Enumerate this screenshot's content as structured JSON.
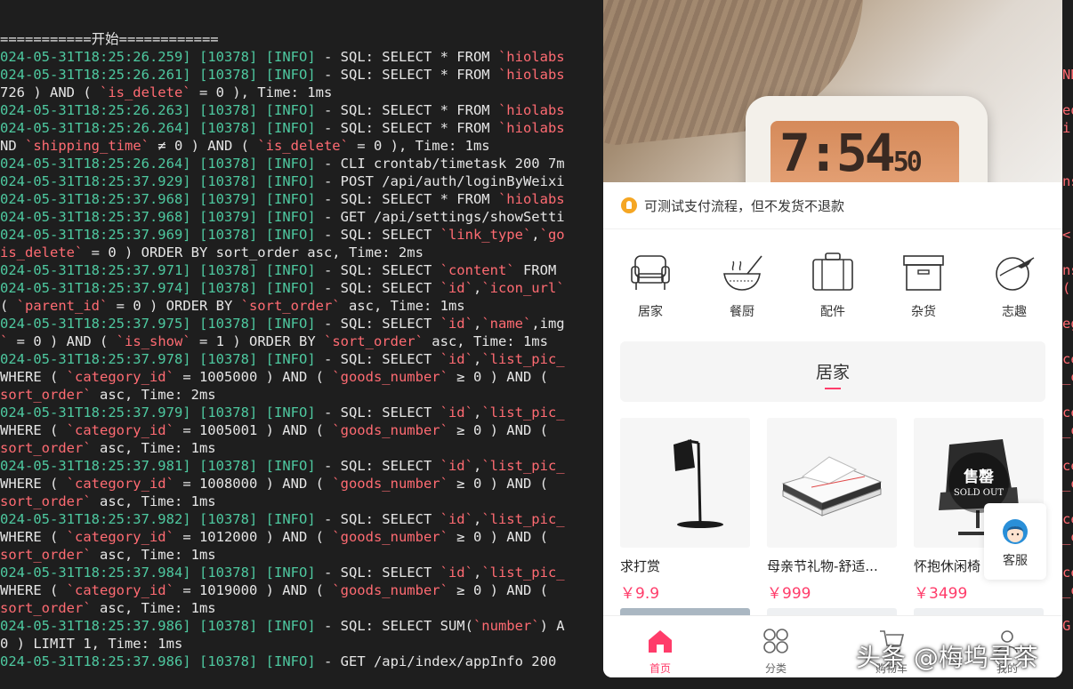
{
  "terminal": {
    "lines": [
      [
        {
          "c": "txt",
          "t": "===========开始============"
        }
      ],
      [
        {
          "c": "ts",
          "t": "024-05-31T18:25:26.259]"
        },
        {
          "c": "txt",
          "t": " "
        },
        {
          "c": "pid",
          "t": "[10378]"
        },
        {
          "c": "txt",
          "t": " "
        },
        {
          "c": "lvl",
          "t": "[INFO]"
        },
        {
          "c": "txt",
          "t": " - SQL: SELECT * FROM "
        },
        {
          "c": "bt",
          "t": "`hiolabs"
        }
      ],
      [
        {
          "c": "ts",
          "t": "024-05-31T18:25:26.261]"
        },
        {
          "c": "txt",
          "t": " "
        },
        {
          "c": "pid",
          "t": "[10378]"
        },
        {
          "c": "txt",
          "t": " "
        },
        {
          "c": "lvl",
          "t": "[INFO]"
        },
        {
          "c": "txt",
          "t": " - SQL: SELECT * FROM "
        },
        {
          "c": "bt",
          "t": "`hiolabs"
        }
      ],
      [
        {
          "c": "txt",
          "t": "726 ) AND ( "
        },
        {
          "c": "bt",
          "t": "`is_delete`"
        },
        {
          "c": "txt",
          "t": " = 0 ), Time: 1ms"
        }
      ],
      [
        {
          "c": "ts",
          "t": "024-05-31T18:25:26.263]"
        },
        {
          "c": "txt",
          "t": " "
        },
        {
          "c": "pid",
          "t": "[10378]"
        },
        {
          "c": "txt",
          "t": " "
        },
        {
          "c": "lvl",
          "t": "[INFO]"
        },
        {
          "c": "txt",
          "t": " - SQL: SELECT * FROM "
        },
        {
          "c": "bt",
          "t": "`hiolabs"
        }
      ],
      [
        {
          "c": "ts",
          "t": "024-05-31T18:25:26.264]"
        },
        {
          "c": "txt",
          "t": " "
        },
        {
          "c": "pid",
          "t": "[10378]"
        },
        {
          "c": "txt",
          "t": " "
        },
        {
          "c": "lvl",
          "t": "[INFO]"
        },
        {
          "c": "txt",
          "t": " - SQL: SELECT * FROM "
        },
        {
          "c": "bt",
          "t": "`hiolabs"
        }
      ],
      [
        {
          "c": "txt",
          "t": "ND "
        },
        {
          "c": "bt",
          "t": "`shipping_time`"
        },
        {
          "c": "txt",
          "t": " ≠ 0 ) AND ( "
        },
        {
          "c": "bt",
          "t": "`is_delete`"
        },
        {
          "c": "txt",
          "t": " = 0 ), Time: 1ms"
        }
      ],
      [
        {
          "c": "ts",
          "t": "024-05-31T18:25:26.264]"
        },
        {
          "c": "txt",
          "t": " "
        },
        {
          "c": "pid",
          "t": "[10378]"
        },
        {
          "c": "txt",
          "t": " "
        },
        {
          "c": "lvl",
          "t": "[INFO]"
        },
        {
          "c": "txt",
          "t": " - CLI crontab/timetask 200 7m"
        }
      ],
      [
        {
          "c": "ts",
          "t": "024-05-31T18:25:37.929]"
        },
        {
          "c": "txt",
          "t": " "
        },
        {
          "c": "pid",
          "t": "[10378]"
        },
        {
          "c": "txt",
          "t": " "
        },
        {
          "c": "lvl",
          "t": "[INFO]"
        },
        {
          "c": "txt",
          "t": " - POST /api/auth/loginByWeixi"
        }
      ],
      [
        {
          "c": "ts",
          "t": "024-05-31T18:25:37.968]"
        },
        {
          "c": "txt",
          "t": " "
        },
        {
          "c": "pid",
          "t": "[10379]"
        },
        {
          "c": "txt",
          "t": " "
        },
        {
          "c": "lvl",
          "t": "[INFO]"
        },
        {
          "c": "txt",
          "t": " - SQL: SELECT * FROM "
        },
        {
          "c": "bt",
          "t": "`hiolabs"
        }
      ],
      [
        {
          "c": "ts",
          "t": "024-05-31T18:25:37.968]"
        },
        {
          "c": "txt",
          "t": " "
        },
        {
          "c": "pid",
          "t": "[10379]"
        },
        {
          "c": "txt",
          "t": " "
        },
        {
          "c": "lvl",
          "t": "[INFO]"
        },
        {
          "c": "txt",
          "t": " - GET /api/settings/showSetti"
        }
      ],
      [
        {
          "c": "ts",
          "t": "024-05-31T18:25:37.969]"
        },
        {
          "c": "txt",
          "t": " "
        },
        {
          "c": "pid",
          "t": "[10378]"
        },
        {
          "c": "txt",
          "t": " "
        },
        {
          "c": "lvl",
          "t": "[INFO]"
        },
        {
          "c": "txt",
          "t": " - SQL: SELECT "
        },
        {
          "c": "bt",
          "t": "`link_type`"
        },
        {
          "c": "txt",
          "t": ","
        },
        {
          "c": "bt",
          "t": "`go"
        }
      ],
      [
        {
          "c": "bt",
          "t": "is_delete`"
        },
        {
          "c": "txt",
          "t": " = 0 ) ORDER BY sort_order asc, Time: 2ms"
        }
      ],
      [
        {
          "c": "ts",
          "t": "024-05-31T18:25:37.971]"
        },
        {
          "c": "txt",
          "t": " "
        },
        {
          "c": "pid",
          "t": "[10378]"
        },
        {
          "c": "txt",
          "t": " "
        },
        {
          "c": "lvl",
          "t": "[INFO]"
        },
        {
          "c": "txt",
          "t": " - SQL: SELECT "
        },
        {
          "c": "bt",
          "t": "`content`"
        },
        {
          "c": "txt",
          "t": " FROM "
        }
      ],
      [
        {
          "c": "ts",
          "t": "024-05-31T18:25:37.974]"
        },
        {
          "c": "txt",
          "t": " "
        },
        {
          "c": "pid",
          "t": "[10378]"
        },
        {
          "c": "txt",
          "t": " "
        },
        {
          "c": "lvl",
          "t": "[INFO]"
        },
        {
          "c": "txt",
          "t": " - SQL: SELECT "
        },
        {
          "c": "bt",
          "t": "`id`"
        },
        {
          "c": "txt",
          "t": ","
        },
        {
          "c": "bt",
          "t": "`icon_url`"
        }
      ],
      [
        {
          "c": "txt",
          "t": "( "
        },
        {
          "c": "bt",
          "t": "`parent_id`"
        },
        {
          "c": "txt",
          "t": " = 0 ) ORDER BY "
        },
        {
          "c": "bt",
          "t": "`sort_order`"
        },
        {
          "c": "txt",
          "t": " asc, Time: 1ms"
        }
      ],
      [
        {
          "c": "ts",
          "t": "024-05-31T18:25:37.975]"
        },
        {
          "c": "txt",
          "t": " "
        },
        {
          "c": "pid",
          "t": "[10378]"
        },
        {
          "c": "txt",
          "t": " "
        },
        {
          "c": "lvl",
          "t": "[INFO]"
        },
        {
          "c": "txt",
          "t": " - SQL: SELECT "
        },
        {
          "c": "bt",
          "t": "`id`"
        },
        {
          "c": "txt",
          "t": ","
        },
        {
          "c": "bt",
          "t": "`name`"
        },
        {
          "c": "txt",
          "t": ",img"
        }
      ],
      [
        {
          "c": "bt",
          "t": "`"
        },
        {
          "c": "txt",
          "t": " = 0 ) AND ( "
        },
        {
          "c": "bt",
          "t": "`is_show`"
        },
        {
          "c": "txt",
          "t": " = 1 ) ORDER BY "
        },
        {
          "c": "bt",
          "t": "`sort_order`"
        },
        {
          "c": "txt",
          "t": " asc, Time: 1ms"
        }
      ],
      [
        {
          "c": "ts",
          "t": "024-05-31T18:25:37.978]"
        },
        {
          "c": "txt",
          "t": " "
        },
        {
          "c": "pid",
          "t": "[10378]"
        },
        {
          "c": "txt",
          "t": " "
        },
        {
          "c": "lvl",
          "t": "[INFO]"
        },
        {
          "c": "txt",
          "t": " - SQL: SELECT "
        },
        {
          "c": "bt",
          "t": "`id`"
        },
        {
          "c": "txt",
          "t": ","
        },
        {
          "c": "bt",
          "t": "`list_pic_"
        }
      ],
      [
        {
          "c": "txt",
          "t": "WHERE ( "
        },
        {
          "c": "bt",
          "t": "`category_id`"
        },
        {
          "c": "txt",
          "t": " = 1005000 ) AND ( "
        },
        {
          "c": "bt",
          "t": "`goods_number`"
        },
        {
          "c": "txt",
          "t": " ≥ 0 ) AND ("
        }
      ],
      [
        {
          "c": "bt",
          "t": "sort_order`"
        },
        {
          "c": "txt",
          "t": " asc, Time: 2ms"
        }
      ],
      [
        {
          "c": "ts",
          "t": "024-05-31T18:25:37.979]"
        },
        {
          "c": "txt",
          "t": " "
        },
        {
          "c": "pid",
          "t": "[10378]"
        },
        {
          "c": "txt",
          "t": " "
        },
        {
          "c": "lvl",
          "t": "[INFO]"
        },
        {
          "c": "txt",
          "t": " - SQL: SELECT "
        },
        {
          "c": "bt",
          "t": "`id`"
        },
        {
          "c": "txt",
          "t": ","
        },
        {
          "c": "bt",
          "t": "`list_pic_"
        }
      ],
      [
        {
          "c": "txt",
          "t": "WHERE ( "
        },
        {
          "c": "bt",
          "t": "`category_id`"
        },
        {
          "c": "txt",
          "t": " = 1005001 ) AND ( "
        },
        {
          "c": "bt",
          "t": "`goods_number`"
        },
        {
          "c": "txt",
          "t": " ≥ 0 ) AND ("
        }
      ],
      [
        {
          "c": "bt",
          "t": "sort_order`"
        },
        {
          "c": "txt",
          "t": " asc, Time: 1ms"
        }
      ],
      [
        {
          "c": "ts",
          "t": "024-05-31T18:25:37.981]"
        },
        {
          "c": "txt",
          "t": " "
        },
        {
          "c": "pid",
          "t": "[10378]"
        },
        {
          "c": "txt",
          "t": " "
        },
        {
          "c": "lvl",
          "t": "[INFO]"
        },
        {
          "c": "txt",
          "t": " - SQL: SELECT "
        },
        {
          "c": "bt",
          "t": "`id`"
        },
        {
          "c": "txt",
          "t": ","
        },
        {
          "c": "bt",
          "t": "`list_pic_"
        }
      ],
      [
        {
          "c": "txt",
          "t": "WHERE ( "
        },
        {
          "c": "bt",
          "t": "`category_id`"
        },
        {
          "c": "txt",
          "t": " = 1008000 ) AND ( "
        },
        {
          "c": "bt",
          "t": "`goods_number`"
        },
        {
          "c": "txt",
          "t": " ≥ 0 ) AND ("
        }
      ],
      [
        {
          "c": "bt",
          "t": "sort_order`"
        },
        {
          "c": "txt",
          "t": " asc, Time: 1ms"
        }
      ],
      [
        {
          "c": "ts",
          "t": "024-05-31T18:25:37.982]"
        },
        {
          "c": "txt",
          "t": " "
        },
        {
          "c": "pid",
          "t": "[10378]"
        },
        {
          "c": "txt",
          "t": " "
        },
        {
          "c": "lvl",
          "t": "[INFO]"
        },
        {
          "c": "txt",
          "t": " - SQL: SELECT "
        },
        {
          "c": "bt",
          "t": "`id`"
        },
        {
          "c": "txt",
          "t": ","
        },
        {
          "c": "bt",
          "t": "`list_pic_"
        }
      ],
      [
        {
          "c": "txt",
          "t": "WHERE ( "
        },
        {
          "c": "bt",
          "t": "`category_id`"
        },
        {
          "c": "txt",
          "t": " = 1012000 ) AND ( "
        },
        {
          "c": "bt",
          "t": "`goods_number`"
        },
        {
          "c": "txt",
          "t": " ≥ 0 ) AND ("
        }
      ],
      [
        {
          "c": "bt",
          "t": "sort_order`"
        },
        {
          "c": "txt",
          "t": " asc, Time: 1ms"
        }
      ],
      [
        {
          "c": "ts",
          "t": "024-05-31T18:25:37.984]"
        },
        {
          "c": "txt",
          "t": " "
        },
        {
          "c": "pid",
          "t": "[10378]"
        },
        {
          "c": "txt",
          "t": " "
        },
        {
          "c": "lvl",
          "t": "[INFO]"
        },
        {
          "c": "txt",
          "t": " - SQL: SELECT "
        },
        {
          "c": "bt",
          "t": "`id`"
        },
        {
          "c": "txt",
          "t": ","
        },
        {
          "c": "bt",
          "t": "`list_pic_"
        }
      ],
      [
        {
          "c": "txt",
          "t": "WHERE ( "
        },
        {
          "c": "bt",
          "t": "`category_id`"
        },
        {
          "c": "txt",
          "t": " = 1019000 ) AND ( "
        },
        {
          "c": "bt",
          "t": "`goods_number`"
        },
        {
          "c": "txt",
          "t": " ≥ 0 ) AND ("
        }
      ],
      [
        {
          "c": "bt",
          "t": "sort_order`"
        },
        {
          "c": "txt",
          "t": " asc, Time: 1ms"
        }
      ],
      [
        {
          "c": "ts",
          "t": "024-05-31T18:25:37.986]"
        },
        {
          "c": "txt",
          "t": " "
        },
        {
          "c": "pid",
          "t": "[10378]"
        },
        {
          "c": "txt",
          "t": " "
        },
        {
          "c": "lvl",
          "t": "[INFO]"
        },
        {
          "c": "txt",
          "t": " - SQL: SELECT SUM("
        },
        {
          "c": "bt",
          "t": "`number`"
        },
        {
          "c": "txt",
          "t": ") A"
        }
      ],
      [
        {
          "c": "txt",
          "t": "0 ) LIMIT 1, Time: 1ms"
        }
      ],
      [
        {
          "c": "ts",
          "t": "024-05-31T18:25:37.986]"
        },
        {
          "c": "txt",
          "t": " "
        },
        {
          "c": "pid",
          "t": "[10378]"
        },
        {
          "c": "txt",
          "t": " "
        },
        {
          "c": "lvl",
          "t": "[INFO]"
        },
        {
          "c": "txt",
          "t": " - GET /api/index/appInfo 200"
        }
      ]
    ],
    "fringe": [
      "",
      "",
      "ND",
      "",
      "ed",
      "ir",
      "",
      "",
      "ns",
      "",
      "",
      "<",
      "",
      "ns",
      "(",
      "",
      "eg",
      "",
      "ce",
      "_o",
      "",
      "ce",
      "_o",
      "",
      "ce",
      "_o",
      "",
      "ce",
      "_o",
      "",
      "ce",
      "_o",
      "",
      "G",
      "",
      ""
    ]
  },
  "app": {
    "banner": {
      "clock_time": "7:54",
      "clock_seconds": "50"
    },
    "notice": {
      "text": "可测试支付流程，但不发货不退款"
    },
    "categories": [
      {
        "label": "居家",
        "icon": "sofa-icon"
      },
      {
        "label": "餐厨",
        "icon": "bowl-icon"
      },
      {
        "label": "配件",
        "icon": "suitcase-icon"
      },
      {
        "label": "杂货",
        "icon": "box-icon"
      },
      {
        "label": "志趣",
        "icon": "plane-globe-icon"
      }
    ],
    "section": {
      "title": "居家"
    },
    "products": [
      {
        "name": "求打赏",
        "price": "￥9.9",
        "image": "desk-lamp"
      },
      {
        "name": "母亲节礼物-舒适...",
        "price": "￥999",
        "image": "bedding"
      },
      {
        "name": "怀抱休闲椅",
        "price": "￥3499",
        "image": "chair",
        "badge_main": "售罄",
        "badge_sub": "SOLD OUT"
      }
    ],
    "service": {
      "label": "客服"
    },
    "tabs": [
      {
        "label": "首页",
        "icon": "home-icon",
        "active": true
      },
      {
        "label": "分类",
        "icon": "grid-icon",
        "active": false
      },
      {
        "label": "购物车",
        "icon": "cart-icon",
        "active": false
      },
      {
        "label": "我的",
        "icon": "user-icon",
        "active": false
      }
    ],
    "colors": {
      "accent": "#ff3c6a",
      "notice_icon": "#f5a623",
      "log_green": "#4ec9a0",
      "log_red": "#ff6b72"
    }
  },
  "watermark": "头条 @梅坞寻茶"
}
